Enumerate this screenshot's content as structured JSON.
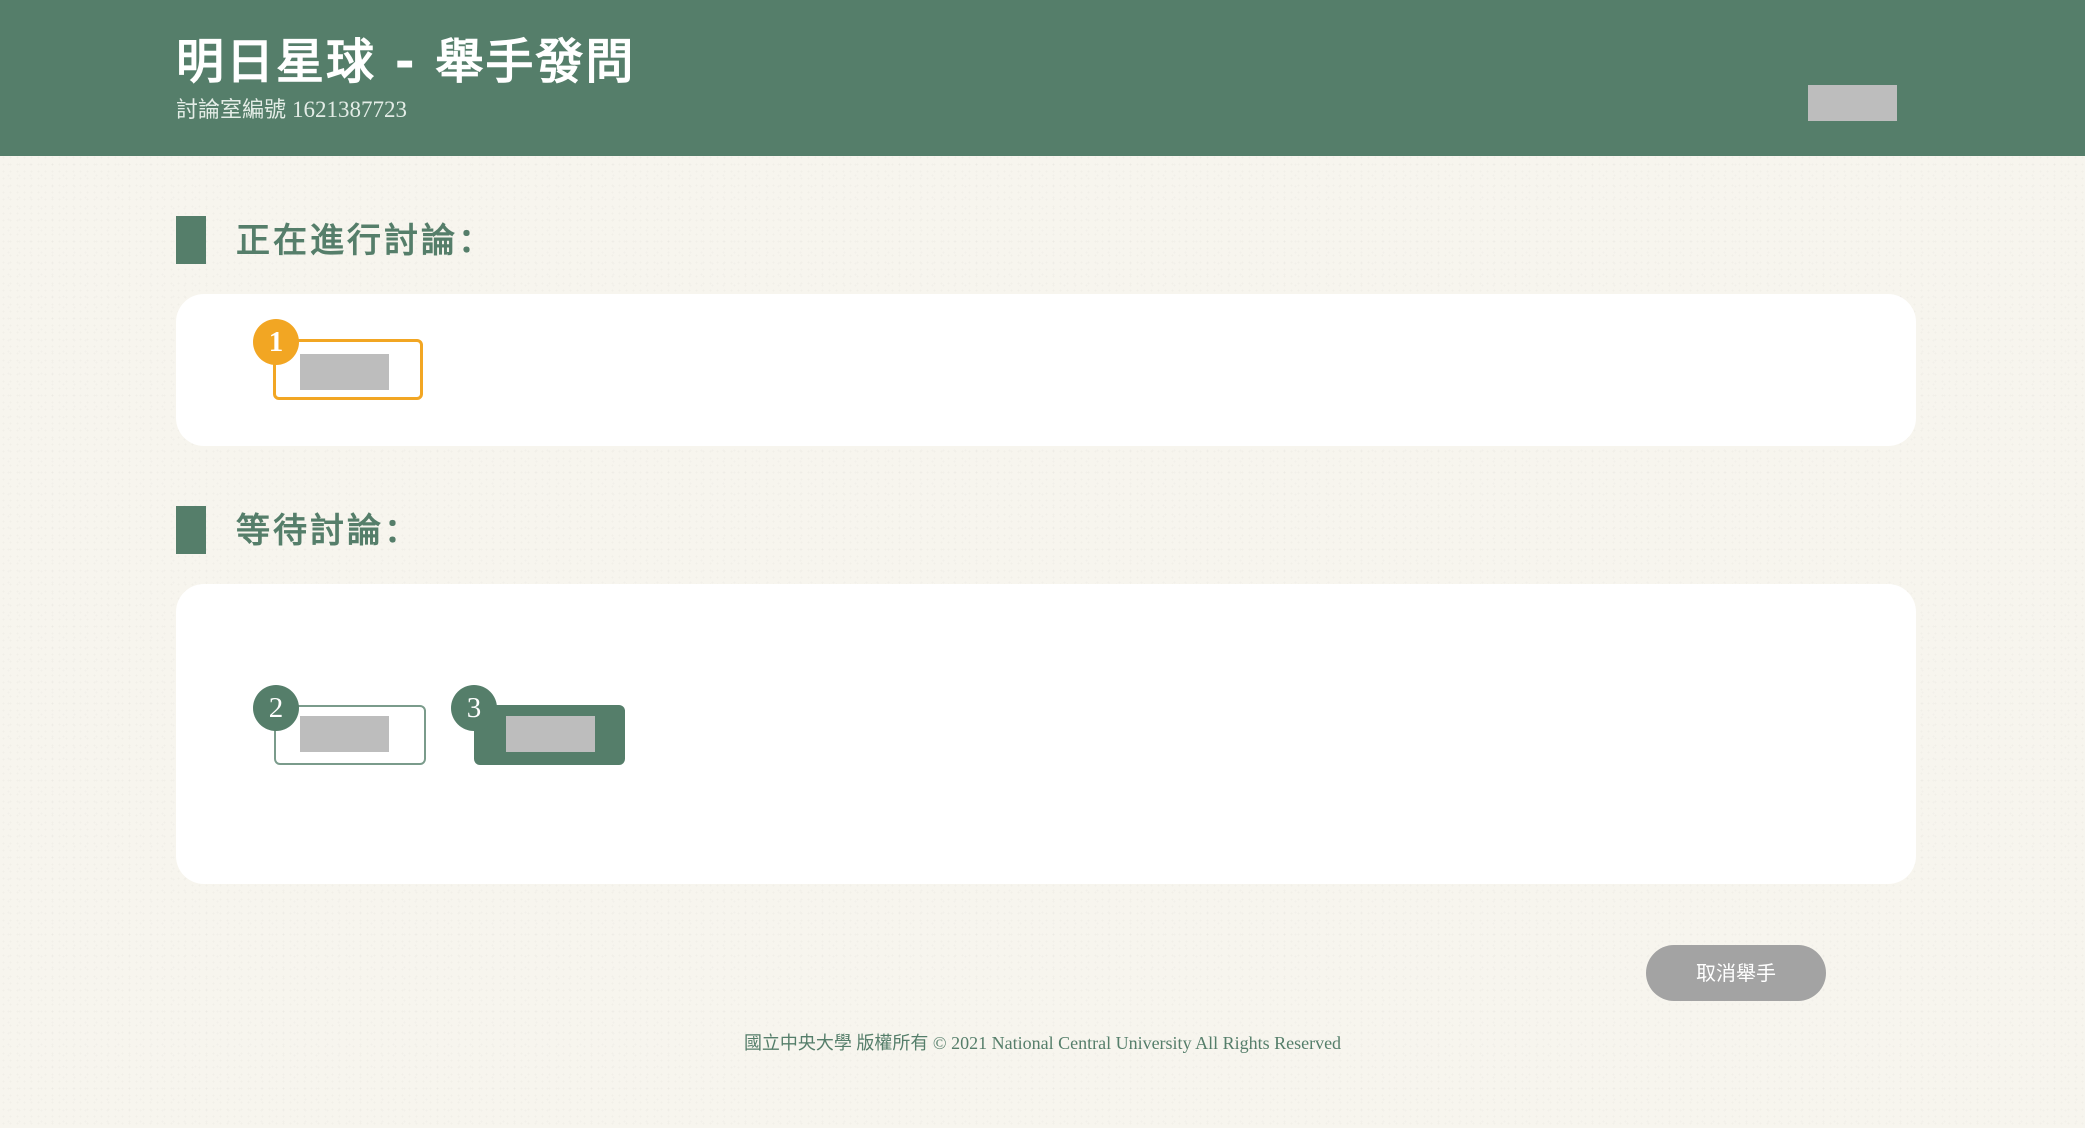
{
  "header": {
    "title": "明日星球 - 舉手發問",
    "room_label": "討論室編號",
    "room_number": "1621387723"
  },
  "sections": {
    "current": {
      "title": "正在進行討論："
    },
    "waiting": {
      "title": "等待討論："
    }
  },
  "queue": {
    "active": [
      {
        "number": "1"
      }
    ],
    "waiting": [
      {
        "number": "2"
      },
      {
        "number": "3"
      }
    ]
  },
  "actions": {
    "cancel_raise_hand": "取消舉手"
  },
  "footer": {
    "copyright": "國立中央大學 版權所有 © 2021 National Central University All Rights Reserved"
  },
  "colors": {
    "primary_green": "#557e6a",
    "accent_orange": "#f2a623",
    "background": "#f7f5ee",
    "panel": "#ffffff",
    "button_gray": "#a3a3a3",
    "redaction_gray": "#bdbdbd"
  }
}
